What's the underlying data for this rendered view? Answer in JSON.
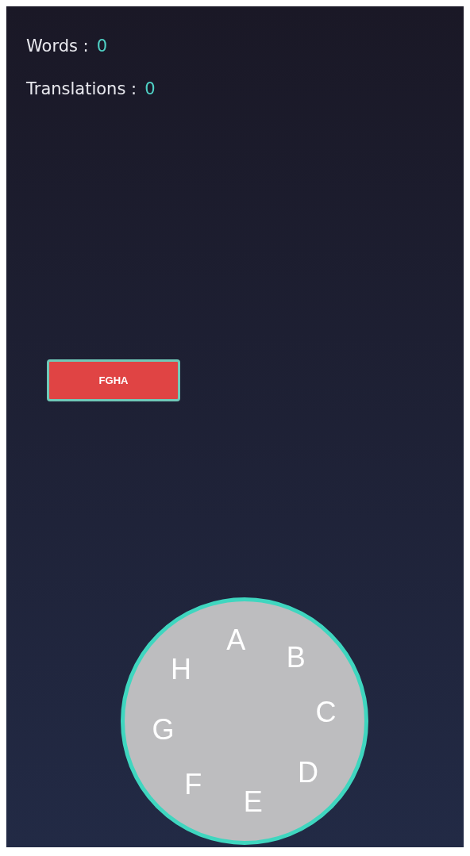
{
  "stats": [
    {
      "label": "Words :",
      "value": "0"
    },
    {
      "label": "Translations :",
      "value": "0"
    }
  ],
  "word_button": {
    "label": "FGHA"
  },
  "letter_wheel": {
    "letters": [
      "A",
      "B",
      "C",
      "D",
      "E",
      "F",
      "G",
      "H"
    ]
  }
}
